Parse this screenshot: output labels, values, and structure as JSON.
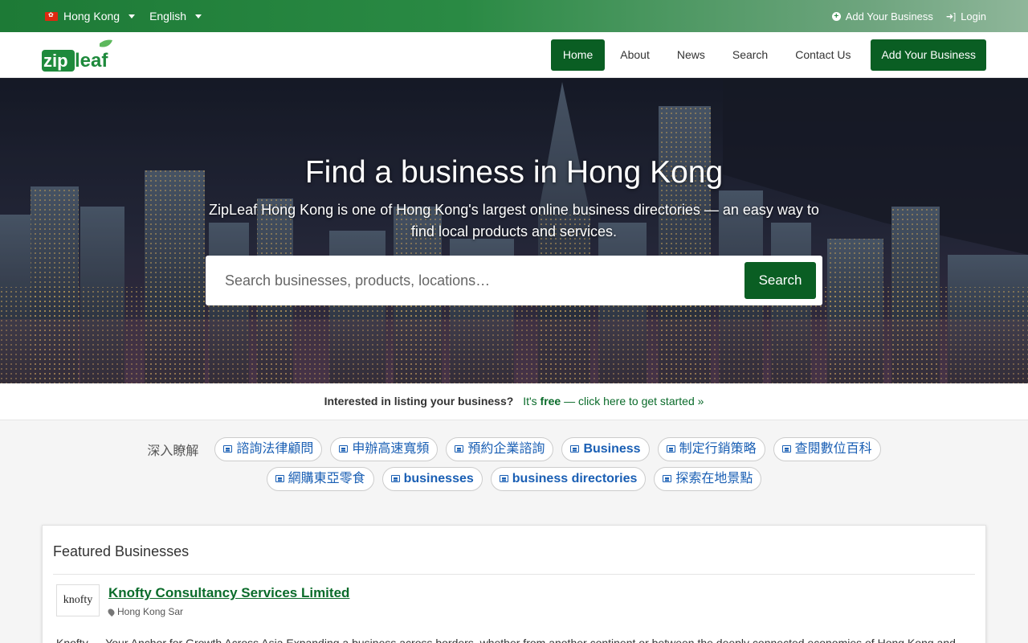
{
  "topbar": {
    "country": "Hong Kong",
    "language": "English",
    "add_business": "Add Your Business",
    "login": "Login"
  },
  "header": {
    "logo_text": "zipleaf",
    "nav": [
      {
        "label": "Home",
        "active": true
      },
      {
        "label": "About",
        "active": false
      },
      {
        "label": "News",
        "active": false
      },
      {
        "label": "Search",
        "active": false
      },
      {
        "label": "Contact Us",
        "active": false
      }
    ],
    "cta": "Add Your Business"
  },
  "hero": {
    "title": "Find a business in Hong Kong",
    "subtitle": "ZipLeaf Hong Kong is one of Hong Kong's largest online business directories — an easy way to find local products and services.",
    "search_placeholder": "Search businesses, products, locations…",
    "search_button": "Search"
  },
  "interest": {
    "question": "Interested in listing your business?",
    "prefix": "It's",
    "free": "free",
    "suffix": "— click here to get started »"
  },
  "tags": {
    "lead": "深入瞭解",
    "row1": [
      {
        "label": "諮詢法律顧問",
        "bold": false
      },
      {
        "label": "申辦高速寬頻",
        "bold": false
      },
      {
        "label": "預約企業諮詢",
        "bold": false
      },
      {
        "label": "Business",
        "bold": true
      },
      {
        "label": "制定行銷策略",
        "bold": false
      },
      {
        "label": "查閱數位百科",
        "bold": false
      }
    ],
    "row2": [
      {
        "label": "網購東亞零食",
        "bold": false
      },
      {
        "label": "businesses",
        "bold": true
      },
      {
        "label": "business directories",
        "bold": true
      },
      {
        "label": "探索在地景點",
        "bold": false
      }
    ]
  },
  "featured": {
    "heading": "Featured Businesses",
    "business": {
      "logo_text": "knofty",
      "name": "Knofty Consultancy Services Limited",
      "location": "Hong Kong Sar",
      "description": "Knofty — Your Anchor for Growth Across Asia Expanding a business across borders, whether from another continent or between the deeply connected economies of Hong Kong and"
    }
  },
  "colors": {
    "brand_green": "#0a5e23",
    "link_blue": "#1a5fb4"
  }
}
